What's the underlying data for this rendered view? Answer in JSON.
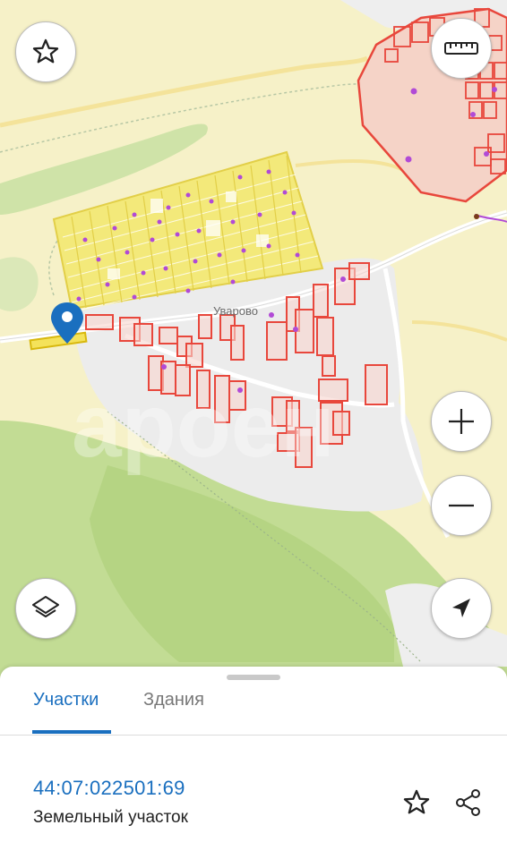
{
  "map": {
    "place_label": "Уварово",
    "watermark_text": "apoeн"
  },
  "controls": {
    "favorite_icon": "star-outline-icon",
    "ruler_icon": "ruler-icon",
    "zoom_in_icon": "plus-icon",
    "zoom_out_icon": "minus-icon",
    "layers_icon": "layers-icon",
    "locate_icon": "navigation-arrow-icon"
  },
  "sheet": {
    "tabs": [
      {
        "label": "Участки",
        "active": true
      },
      {
        "label": "Здания",
        "active": false
      }
    ],
    "result": {
      "cadastral_number": "44:07:022501:69",
      "object_type": "Земельный участок",
      "favorite_icon": "star-outline-icon",
      "share_icon": "share-icon"
    }
  },
  "colors": {
    "accent": "#1a6fbf",
    "parcel_outline": "#e8473c",
    "parcel_fill": "#f9d6cf",
    "selected_parcel": "#f4e25a",
    "marker": "#1a6fbf",
    "point": "#b14ad6"
  }
}
